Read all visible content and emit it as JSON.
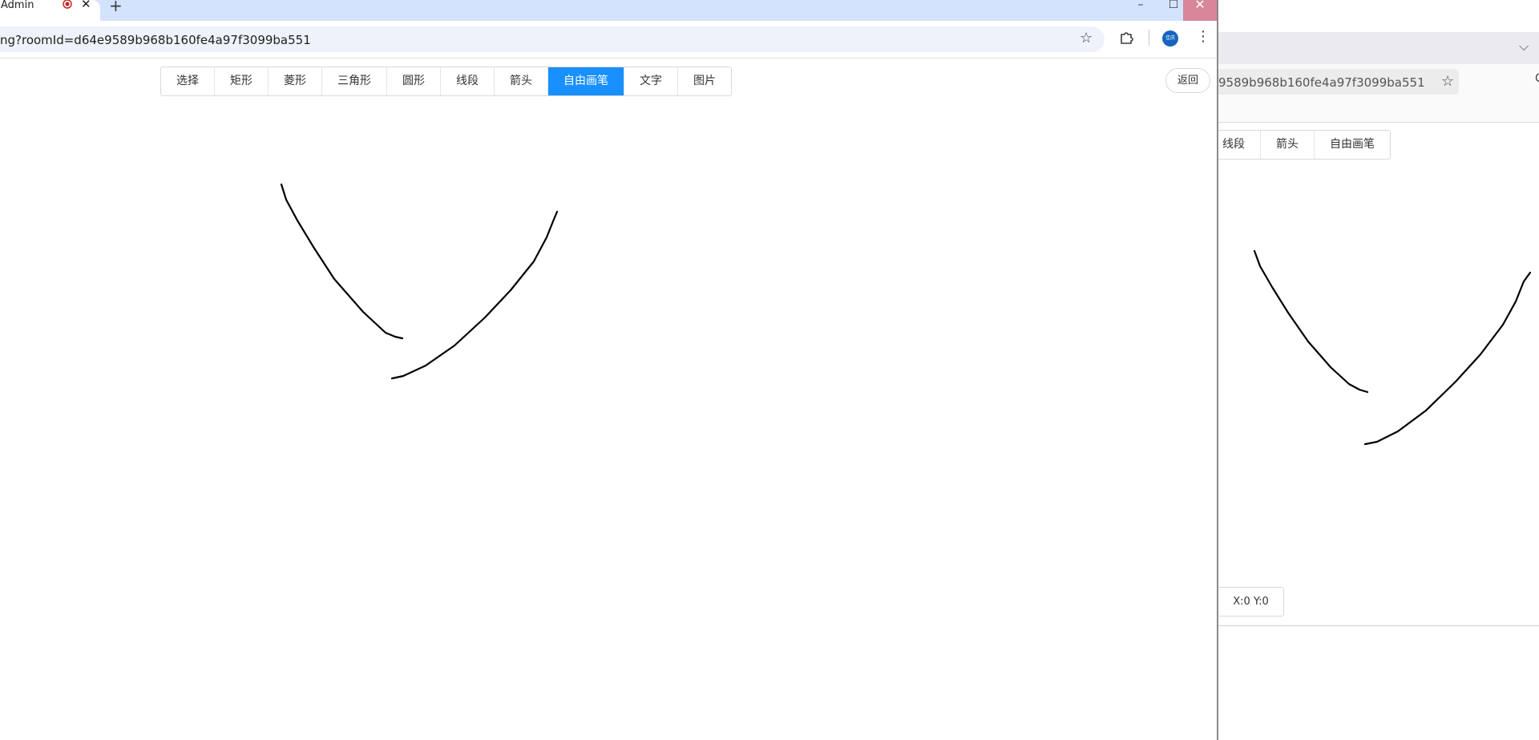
{
  "left_window": {
    "tab_title": "Admin",
    "new_tab_symbol": "+",
    "tab_close_symbol": "✕",
    "url": "ng?roomId=d64e9589b968b160fe4a97f3099ba551",
    "profile_text": "佳庆",
    "window_controls": {
      "minimize": "–",
      "maximize": "☐",
      "close": "✕"
    },
    "toolbar": {
      "tools": [
        "选择",
        "矩形",
        "菱形",
        "三角形",
        "圆形",
        "线段",
        "箭头",
        "自由画笔",
        "文字",
        "图片"
      ],
      "active_tool": "自由画笔"
    },
    "back_label": "返回"
  },
  "right_window": {
    "url": "9589b968b160fe4a97f3099ba551",
    "toolbar": {
      "tools": [
        "线段",
        "箭头",
        "自由画笔"
      ]
    },
    "coords_label": "X:0 Y:0"
  },
  "icons": {
    "recording": "recording-icon",
    "star": "bookmark-star-icon",
    "extensions": "puzzle-icon",
    "menu": "kebab-menu-icon",
    "chevron": "chevron-down-icon"
  },
  "colors": {
    "tabbar": "#d3e3fd",
    "active_tool": "#1890ff",
    "close_button": "#d9869a",
    "stroke": "#000000"
  }
}
